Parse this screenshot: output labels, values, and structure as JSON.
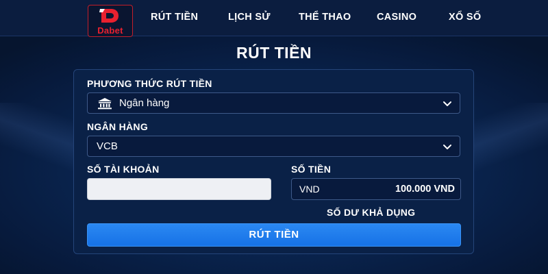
{
  "brand": {
    "logo_text": "Dabet",
    "logo_color": "#e8212f"
  },
  "nav": {
    "items": [
      {
        "label": "RÚT TIỀN"
      },
      {
        "label": "LỊCH SỬ"
      },
      {
        "label": "THỂ THAO"
      },
      {
        "label": "CASINO"
      },
      {
        "label": "XỔ SỐ"
      }
    ]
  },
  "page": {
    "title": "RÚT TIỀN"
  },
  "form": {
    "method": {
      "label": "PHƯƠNG THỨC RÚT TIỀN",
      "value": "Ngân hàng",
      "icon": "bank-icon"
    },
    "bank": {
      "label": "NGÂN HÀNG",
      "value": "VCB"
    },
    "account": {
      "label": "SỐ TÀI KHOẢN",
      "value": ""
    },
    "amount": {
      "label": "SỐ TIỀN",
      "currency": "VND",
      "value": "100.000 VND"
    },
    "balance_label": "SỐ DƯ KHẢ DỤNG",
    "submit_label": "RÚT TIỀN"
  },
  "colors": {
    "accent": "#1e7ef0",
    "background": "#0a2550",
    "panel": "#0a2147"
  }
}
